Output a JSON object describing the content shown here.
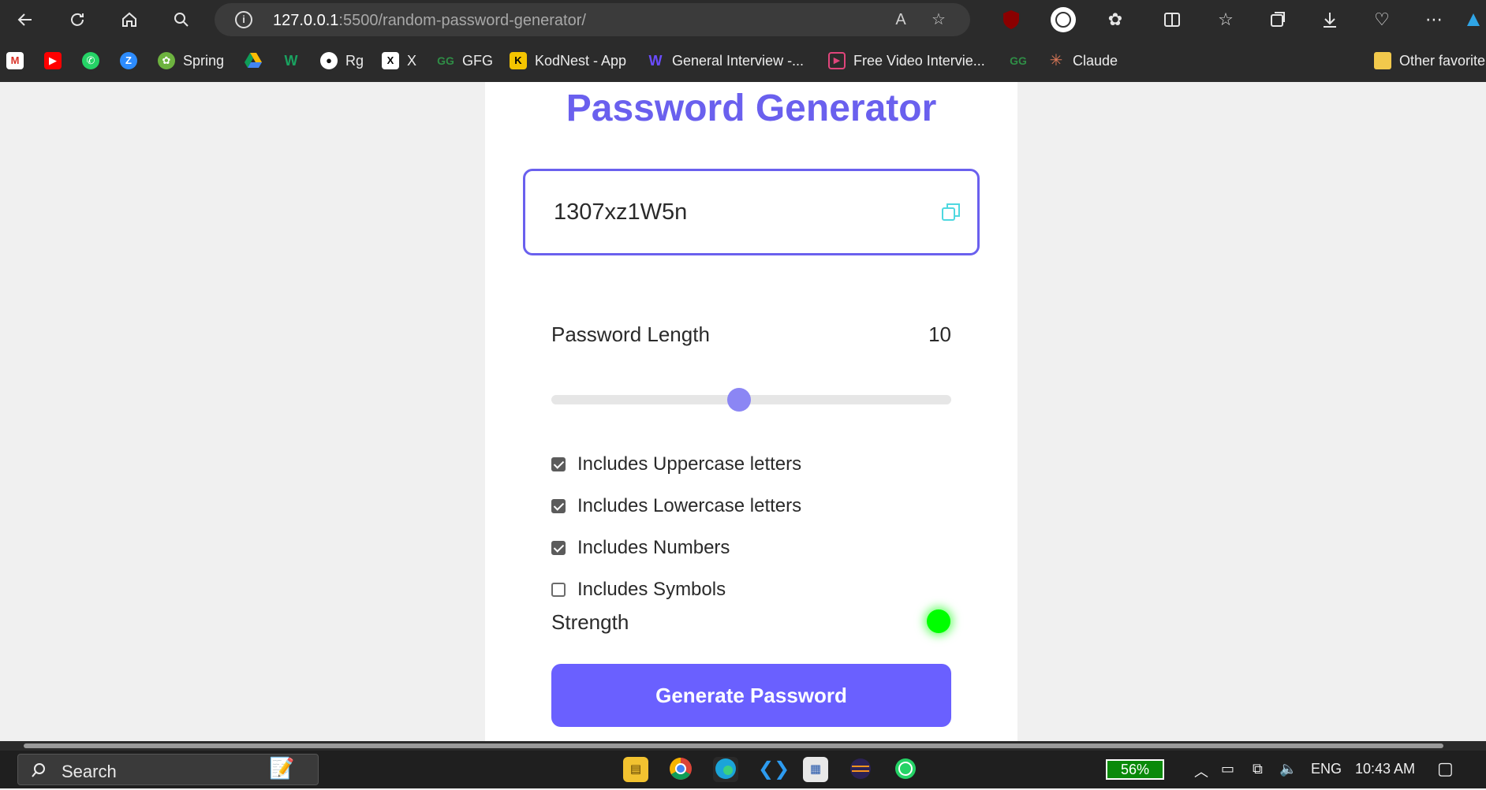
{
  "browser": {
    "url_host": "127.0.0.1",
    "url_path": ":5500/random-password-generator/",
    "bookmarks": [
      {
        "label": "",
        "icon": "gmail-icon"
      },
      {
        "label": "",
        "icon": "youtube-icon"
      },
      {
        "label": "",
        "icon": "whatsapp-icon"
      },
      {
        "label": "",
        "icon": "zoom-icon"
      },
      {
        "label": "Spring",
        "icon": "spring-icon"
      },
      {
        "label": "",
        "icon": "google-drive-icon"
      },
      {
        "label": "",
        "icon": "w-icon"
      },
      {
        "label": "Rg",
        "icon": "github-icon"
      },
      {
        "label": "X",
        "icon": "x-icon"
      },
      {
        "label": "GFG",
        "icon": "gfg-icon"
      },
      {
        "label": "KodNest - App",
        "icon": "kodnest-icon"
      },
      {
        "label": "General Interview -...",
        "icon": "w-purple-icon"
      },
      {
        "label": "Free Video Intervie...",
        "icon": "video-icon"
      },
      {
        "label": "",
        "icon": "gfg-icon"
      },
      {
        "label": "Claude",
        "icon": "claude-icon"
      },
      {
        "label": "Other favorite",
        "icon": "folder-icon"
      }
    ]
  },
  "app": {
    "title": "Password Generator",
    "password": "1307xz1W5n",
    "length_label": "Password Length",
    "length_value": "10",
    "slider_fraction": 0.47,
    "options": [
      {
        "label": "Includes Uppercase letters",
        "checked": true
      },
      {
        "label": "Includes Lowercase letters",
        "checked": true
      },
      {
        "label": "Includes Numbers",
        "checked": true
      },
      {
        "label": "Includes Symbols",
        "checked": false
      }
    ],
    "strength_label": "Strength",
    "strength_color": "#00ff00",
    "generate_label": "Generate Password",
    "accent_color": "#6a60ee"
  },
  "taskbar": {
    "search_label": "Search",
    "battery": "56%",
    "language": "ENG",
    "time": "10:43 AM"
  }
}
